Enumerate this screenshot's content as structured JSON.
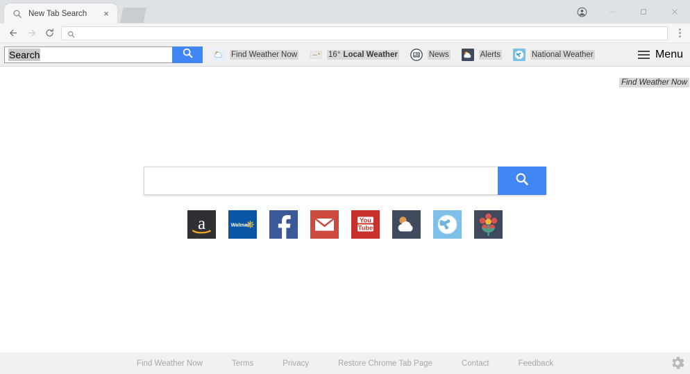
{
  "window": {
    "controls": [
      {
        "name": "profile-avatar",
        "icon": "person-icon",
        "label": ""
      },
      {
        "name": "minimize",
        "icon": "minimize-icon",
        "label": ""
      },
      {
        "name": "maximize",
        "icon": "maximize-icon",
        "label": ""
      },
      {
        "name": "close",
        "icon": "close-icon",
        "label": ""
      }
    ]
  },
  "tab": {
    "title": "New Tab Search",
    "favicon": "search-icon",
    "close_label": "×"
  },
  "navbar": {
    "back_icon": "back-arrow-icon",
    "forward_icon": "forward-arrow-icon",
    "reload_icon": "reload-icon",
    "omnibox_value": "",
    "omnibox_icon": "search-icon",
    "menu_icon": "three-dot-menu-icon"
  },
  "ext_toolbar": {
    "search_value": "Search",
    "search_button_icon": "search-icon",
    "items": [
      {
        "label": "Find Weather Now",
        "icon": "partly-cloudy-icon",
        "bold": false,
        "prefix": ""
      },
      {
        "label": "Local Weather",
        "icon": "broken-image-icon",
        "bold": true,
        "prefix": "16° "
      },
      {
        "label": "News",
        "icon": "newspaper-icon",
        "bold": false,
        "prefix": ""
      },
      {
        "label": "Alerts",
        "icon": "weather-alert-icon",
        "bold": false,
        "prefix": ""
      },
      {
        "label": "National Weather",
        "icon": "globe-icon",
        "bold": false,
        "prefix": ""
      }
    ],
    "menu_label": "Menu",
    "menu_icon": "hamburger-icon"
  },
  "page": {
    "tooltip": "Find Weather Now",
    "search_placeholder": "",
    "search_value": "",
    "search_button_icon": "search-icon",
    "shortcuts": [
      {
        "name": "amazon",
        "label": "a",
        "icon": "amazon-icon"
      },
      {
        "name": "walmart",
        "label": "Walmart",
        "icon": "walmart-icon"
      },
      {
        "name": "facebook",
        "label": "f",
        "icon": "facebook-icon"
      },
      {
        "name": "gmail",
        "label": "",
        "icon": "gmail-icon"
      },
      {
        "name": "youtube",
        "label": "You Tube",
        "icon": "youtube-icon"
      },
      {
        "name": "weather",
        "label": "",
        "icon": "partly-cloudy-icon"
      },
      {
        "name": "globe",
        "label": "",
        "icon": "globe-icon"
      },
      {
        "name": "flower",
        "label": "",
        "icon": "flower-icon"
      }
    ]
  },
  "footer": {
    "links": [
      "Find Weather Now",
      "Terms",
      "Privacy",
      "Restore Chrome Tab Page",
      "Contact",
      "Feedback"
    ],
    "settings_icon": "gear-icon"
  },
  "colors": {
    "accent_blue": "#4285f4",
    "tabstrip": "#dee1e6",
    "toolbar_bg": "#f0f0f0",
    "footer_bg": "#f1f1f1",
    "highlight": "#d9d9d9"
  }
}
